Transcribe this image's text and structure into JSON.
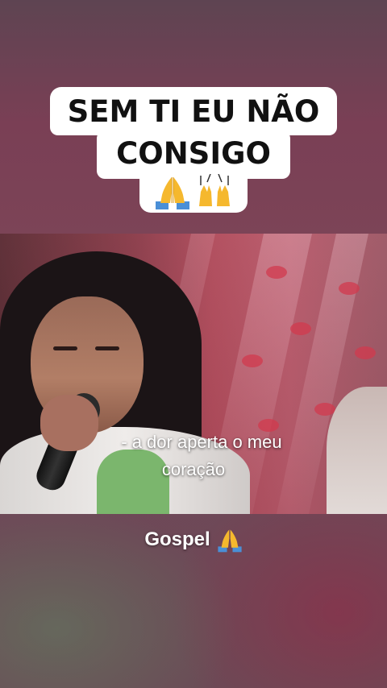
{
  "title": {
    "line1": "SEM TI EU NÃO",
    "line2": "CONSIGO",
    "emojis": [
      "praying-hands",
      "raising-hands"
    ]
  },
  "video": {
    "subtitle_line1": "a dor aperta o meu",
    "subtitle_line2": "coração"
  },
  "caption": {
    "text": "Gospel",
    "emoji": "praying-hands"
  },
  "colors": {
    "caption_bg": "#ffffff",
    "caption_text": "#111111",
    "emoji_yellow": "#f5b82e",
    "emoji_blue": "#4a8fd6"
  }
}
